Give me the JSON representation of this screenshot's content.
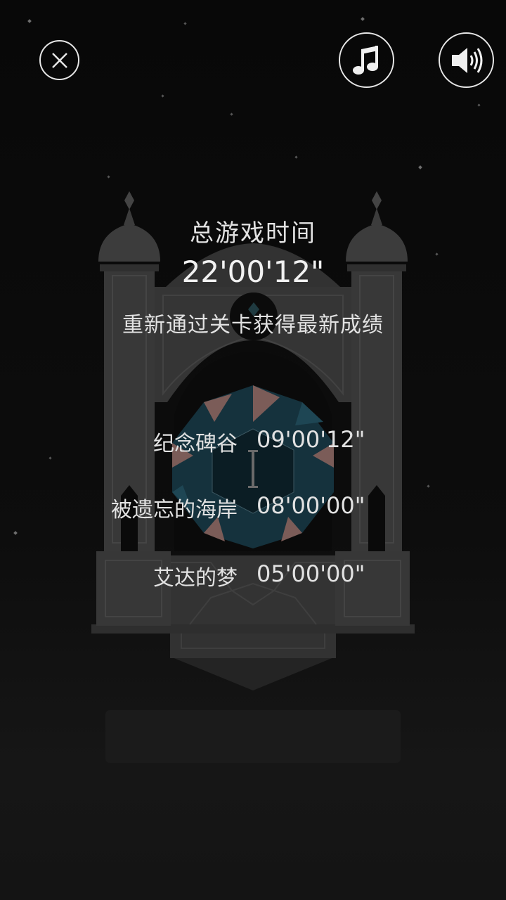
{
  "top_bar": {
    "close_icon": "close-icon",
    "music_icon": "music-note-icon",
    "sound_icon": "speaker-icon"
  },
  "summary": {
    "total_label": "总游戏时间",
    "total_time": "22'00'12\"",
    "hint": "重新通过关卡获得最新成绩"
  },
  "chapters": [
    {
      "name": "纪念碑谷",
      "time": "09'00'12\""
    },
    {
      "name": "被遗忘的海岸",
      "time": "08'00'00\""
    },
    {
      "name": "艾达的梦",
      "time": "05'00'00\""
    }
  ],
  "colors": {
    "background": "#0b0b0b",
    "monument": "#3a3a3a",
    "text": "#e2e2e2",
    "gem_teal": "#163845",
    "gem_pink": "#8a6a66"
  }
}
